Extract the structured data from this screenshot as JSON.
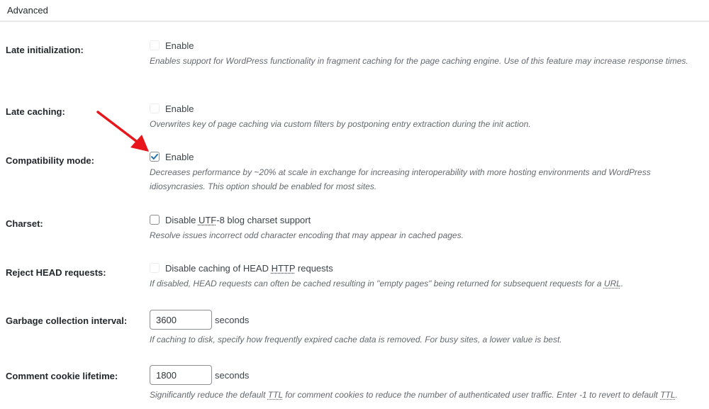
{
  "section": {
    "title": "Advanced"
  },
  "settings": [
    {
      "label": "Late initialization:",
      "type": "checkbox",
      "checked": false,
      "disabled": true,
      "option_label": "Enable",
      "description": "Enables support for WordPress functionality in fragment caching for the page caching engine. Use of this feature may increase response times."
    },
    {
      "label": "Late caching:",
      "type": "checkbox",
      "checked": false,
      "disabled": true,
      "option_label": "Enable",
      "description": "Overwrites key of page caching via custom filters by postponing entry extraction during the init action."
    },
    {
      "label": "Compatibility mode:",
      "type": "checkbox",
      "checked": true,
      "disabled": false,
      "option_label": "Enable",
      "description": "Decreases performance by ~20% at scale in exchange for increasing interoperability with more hosting environments and WordPress idiosyncrasies. This option should be enabled for most sites."
    },
    {
      "label": "Charset:",
      "type": "checkbox",
      "checked": false,
      "disabled": false,
      "option_label_pre": "Disable ",
      "option_label_abbr": "UTF",
      "option_label_post": "-8 blog charset support",
      "description": "Resolve issues incorrect odd character encoding that may appear in cached pages."
    },
    {
      "label": "Reject HEAD requests:",
      "type": "checkbox",
      "checked": false,
      "disabled": true,
      "option_label_pre": "Disable caching of HEAD ",
      "option_label_abbr": "HTTP",
      "option_label_post": " requests",
      "description_pre": "If disabled, HEAD requests can often be cached resulting in \"empty pages\" being returned for subsequent requests for a ",
      "description_abbr": "URL",
      "description_post": "."
    },
    {
      "label": "Garbage collection interval:",
      "type": "number",
      "value": "3600",
      "unit": "seconds",
      "description": "If caching to disk, specify how frequently expired cache data is removed. For busy sites, a lower value is best."
    },
    {
      "label": "Comment cookie lifetime:",
      "type": "number",
      "value": "1800",
      "unit": "seconds",
      "description_pre": "Significantly reduce the default ",
      "description_abbr": "TTL",
      "description_mid": " for comment cookies to reduce the number of authenticated user traffic. Enter -1 to revert to default ",
      "description_abbr2": "TTL",
      "description_post": "."
    }
  ],
  "annotation": {
    "color": "#e8161b",
    "points_to": "Compatibility mode checkbox"
  }
}
